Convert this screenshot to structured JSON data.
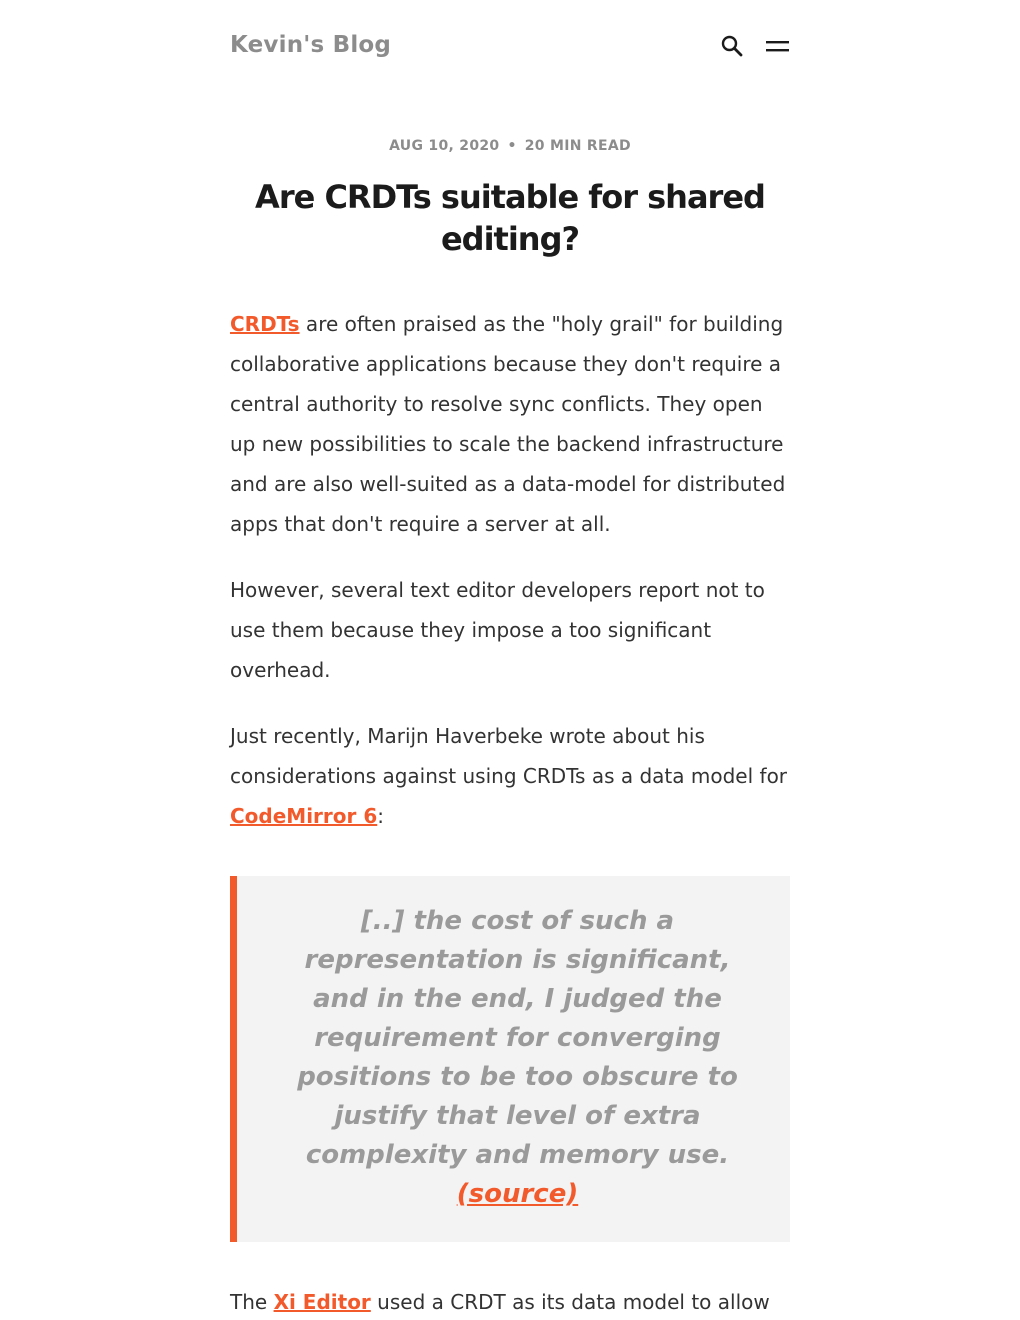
{
  "site": {
    "title": "Kevin's Blog",
    "search_icon": "search-icon",
    "menu_icon": "hamburger-menu-icon"
  },
  "post": {
    "date": "AUG 10, 2020",
    "separator": "•",
    "read_time": "20 MIN READ",
    "title": "Are CRDTs suitable for shared editing?",
    "p1": {
      "link": "CRDTs",
      "text": " are often praised as the \"holy grail\" for building collaborative applications because they don't require a central authority to resolve sync conflicts. They open up new possibilities to scale the backend infrastructure and are also well-suited as a data-model for distributed apps that don't require a server at all."
    },
    "p2": "However, several text editor developers report not to use them because they impose a too significant overhead.",
    "p3": {
      "text_before": "Just recently, Marijn Haverbeke wrote about his considerations against using CRDTs as a data model for ",
      "link": "CodeMirror 6",
      "text_after": ":"
    },
    "quote": {
      "text": "[..] the cost of such a representation is significant, and in the end, I judged the requirement for converging positions to be too obscure to justify that level of extra complexity and memory use.",
      "source_link": "(source)"
    },
    "p4": {
      "text_before": "The ",
      "link": "Xi Editor",
      "text_after": " used a CRDT as its data model to allow"
    }
  },
  "colors": {
    "accent": "#f25a2c",
    "muted": "#8c8c8c",
    "quote_bg": "#f3f3f3"
  }
}
